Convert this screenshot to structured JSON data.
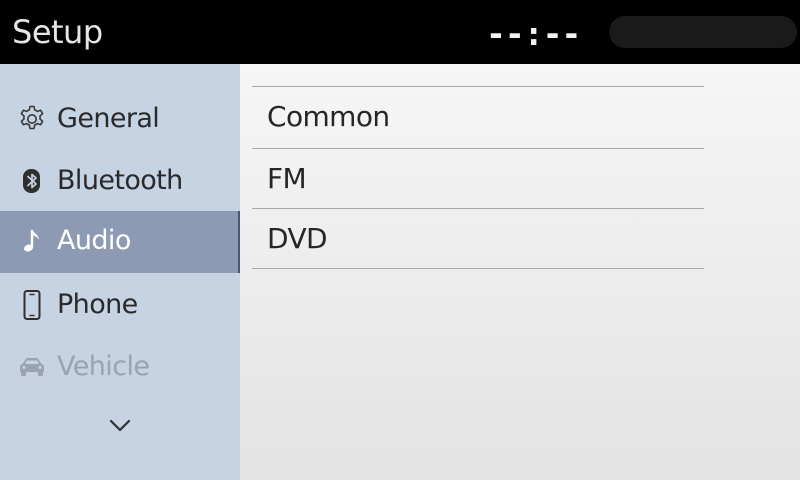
{
  "header": {
    "title": "Setup",
    "clock": "--:--"
  },
  "sidebar": {
    "items": [
      {
        "label": "General",
        "icon": "gear-icon",
        "state": "normal"
      },
      {
        "label": "Bluetooth",
        "icon": "bluetooth-icon",
        "state": "normal"
      },
      {
        "label": "Audio",
        "icon": "music-note-icon",
        "state": "selected"
      },
      {
        "label": "Phone",
        "icon": "phone-icon",
        "state": "normal"
      },
      {
        "label": "Vehicle",
        "icon": "car-icon",
        "state": "disabled"
      }
    ],
    "scroll_icon": "chevron-down-icon"
  },
  "main": {
    "items": [
      {
        "label": "Common"
      },
      {
        "label": "FM"
      },
      {
        "label": "DVD"
      }
    ]
  },
  "colors": {
    "header_bg": "#000000",
    "sidebar_bg": "#c6d3e3",
    "sidebar_selected_bg": "#8d9ab4",
    "main_bg": "#efefef",
    "text": "#262626",
    "disabled_text": "#9aa3ae"
  }
}
